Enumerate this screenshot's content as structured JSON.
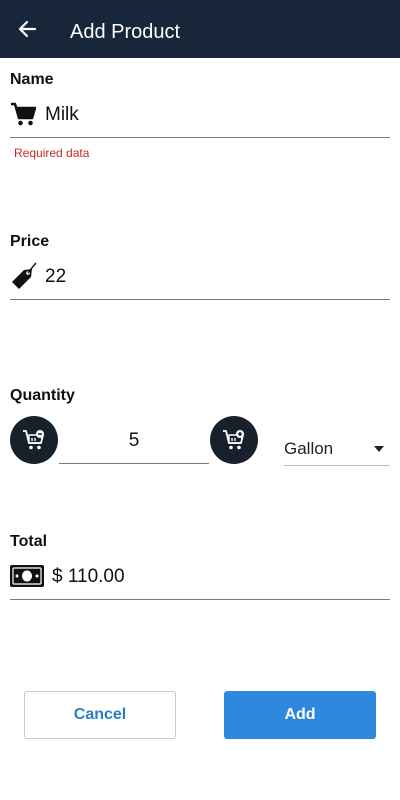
{
  "header": {
    "title": "Add Product",
    "back_icon": "arrow-left-icon"
  },
  "name_field": {
    "label": "Name",
    "value": "Milk",
    "error": "Required data",
    "icon": "cart-icon"
  },
  "price_field": {
    "label": "Price",
    "value": "22",
    "icon": "price-tag-icon"
  },
  "quantity_field": {
    "label": "Quantity",
    "value": "5",
    "unit": "Gallon",
    "decrement_icon": "cart-minus-icon",
    "increment_icon": "cart-plus-icon"
  },
  "total_field": {
    "label": "Total",
    "value": "$ 110.00",
    "icon": "cash-icon"
  },
  "actions": {
    "cancel_label": "Cancel",
    "add_label": "Add"
  },
  "colors": {
    "appbar": "#172638",
    "primary": "#2e89de",
    "error": "#c62828",
    "accent_text": "#2a7dc9"
  }
}
